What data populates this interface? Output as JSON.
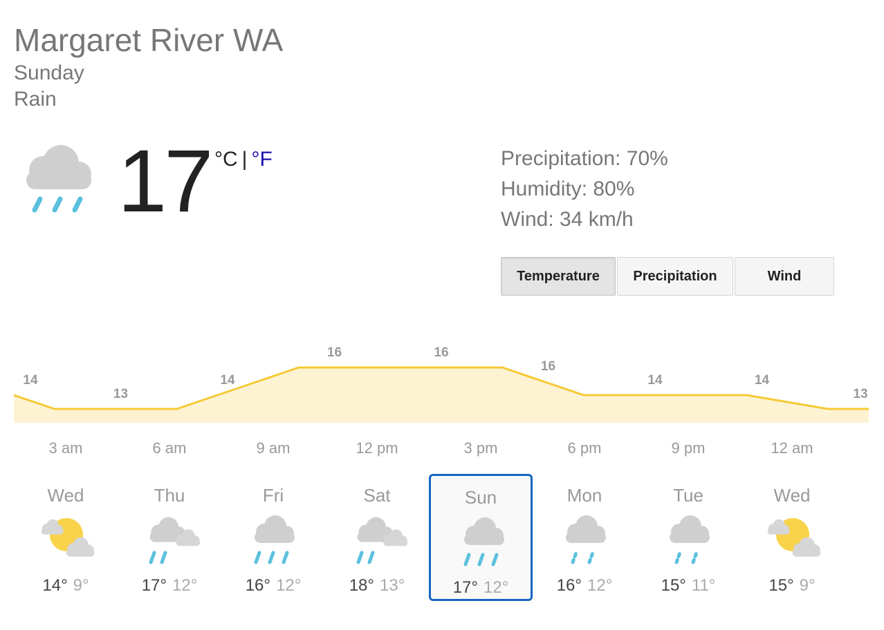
{
  "location": "Margaret River WA",
  "day": "Sunday",
  "condition": "Rain",
  "current": {
    "temperature": "17",
    "unit_c": "°C",
    "unit_sep": "|",
    "unit_f": "°F",
    "icon": "rain-icon",
    "precipitation": "Precipitation: 70%",
    "humidity": "Humidity: 80%",
    "wind": "Wind: 34 km/h"
  },
  "tabs": [
    {
      "label": "Temperature",
      "active": true
    },
    {
      "label": "Precipitation",
      "active": false
    },
    {
      "label": "Wind",
      "active": false
    }
  ],
  "colors": {
    "line": "#f6c935",
    "fill": "#fdf3d3",
    "selected_border": "#1565c0",
    "link": "#1a0dab",
    "rain": "#5bc0de",
    "sun": "#f8d34a",
    "cloud": "#cfcfcf"
  },
  "chart_data": {
    "type": "area",
    "values": [
      14,
      13,
      13,
      13,
      13,
      14,
      15,
      16,
      16,
      16,
      16,
      16,
      16,
      15,
      14,
      14,
      14,
      14,
      14,
      13.5,
      13,
      13
    ],
    "labels": [
      {
        "i": 0,
        "text": "14"
      },
      {
        "i": 3,
        "text": "13"
      },
      {
        "i": 6,
        "text": "14"
      },
      {
        "i": 9,
        "text": "16"
      },
      {
        "i": 12,
        "text": "16"
      },
      {
        "i": 15,
        "text": "16"
      },
      {
        "i": 18,
        "text": "14"
      },
      {
        "i": 21,
        "text": "14"
      },
      {
        "i": 24,
        "text": "13"
      }
    ],
    "hours": [
      "3 am",
      "6 am",
      "9 am",
      "12 pm",
      "3 pm",
      "6 pm",
      "9 pm",
      "12 am"
    ],
    "ylim": [
      12,
      17
    ]
  },
  "forecast": [
    {
      "day": "Wed",
      "icon": "partly-cloudy-icon",
      "hi": "14°",
      "lo": "9°",
      "selected": false
    },
    {
      "day": "Thu",
      "icon": "showers-icon",
      "hi": "17°",
      "lo": "12°",
      "selected": false
    },
    {
      "day": "Fri",
      "icon": "rain-icon",
      "hi": "16°",
      "lo": "12°",
      "selected": false
    },
    {
      "day": "Sat",
      "icon": "showers-icon",
      "hi": "18°",
      "lo": "13°",
      "selected": false
    },
    {
      "day": "Sun",
      "icon": "rain-icon",
      "hi": "17°",
      "lo": "12°",
      "selected": true
    },
    {
      "day": "Mon",
      "icon": "light-rain-icon",
      "hi": "16°",
      "lo": "12°",
      "selected": false
    },
    {
      "day": "Tue",
      "icon": "light-rain-icon",
      "hi": "15°",
      "lo": "11°",
      "selected": false
    },
    {
      "day": "Wed",
      "icon": "partly-cloudy-icon",
      "hi": "15°",
      "lo": "9°",
      "selected": false
    }
  ]
}
